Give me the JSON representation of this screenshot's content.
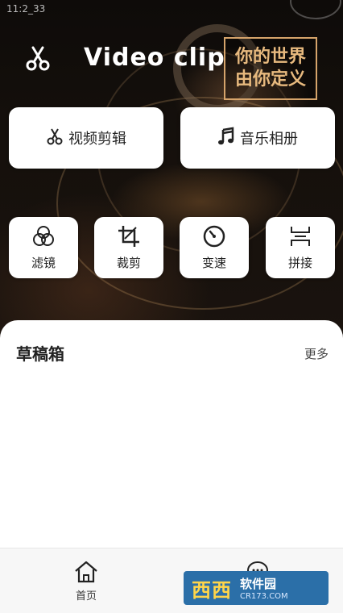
{
  "status_bar": {
    "time": "11:2_33"
  },
  "header": {
    "app_title": "Video clip",
    "slogan_line1": "你的世界",
    "slogan_line2": "由你定义"
  },
  "main_actions": [
    {
      "label": "视频剪辑",
      "icon": "scissors-icon"
    },
    {
      "label": "音乐相册",
      "icon": "music-note-icon"
    }
  ],
  "tools": [
    {
      "label": "滤镜",
      "icon": "filter-circles-icon"
    },
    {
      "label": "裁剪",
      "icon": "crop-icon"
    },
    {
      "label": "变速",
      "icon": "speed-gauge-icon"
    },
    {
      "label": "拼接",
      "icon": "splice-icon"
    }
  ],
  "drafts": {
    "title": "草稿箱",
    "more": "更多"
  },
  "tabbar": {
    "tabs": [
      {
        "label": "首页",
        "icon": "home-icon"
      },
      {
        "label": "",
        "icon": "chat-icon"
      }
    ]
  },
  "watermark": {
    "brand": "西西",
    "text": "软件园",
    "url": "CR173.COM"
  }
}
